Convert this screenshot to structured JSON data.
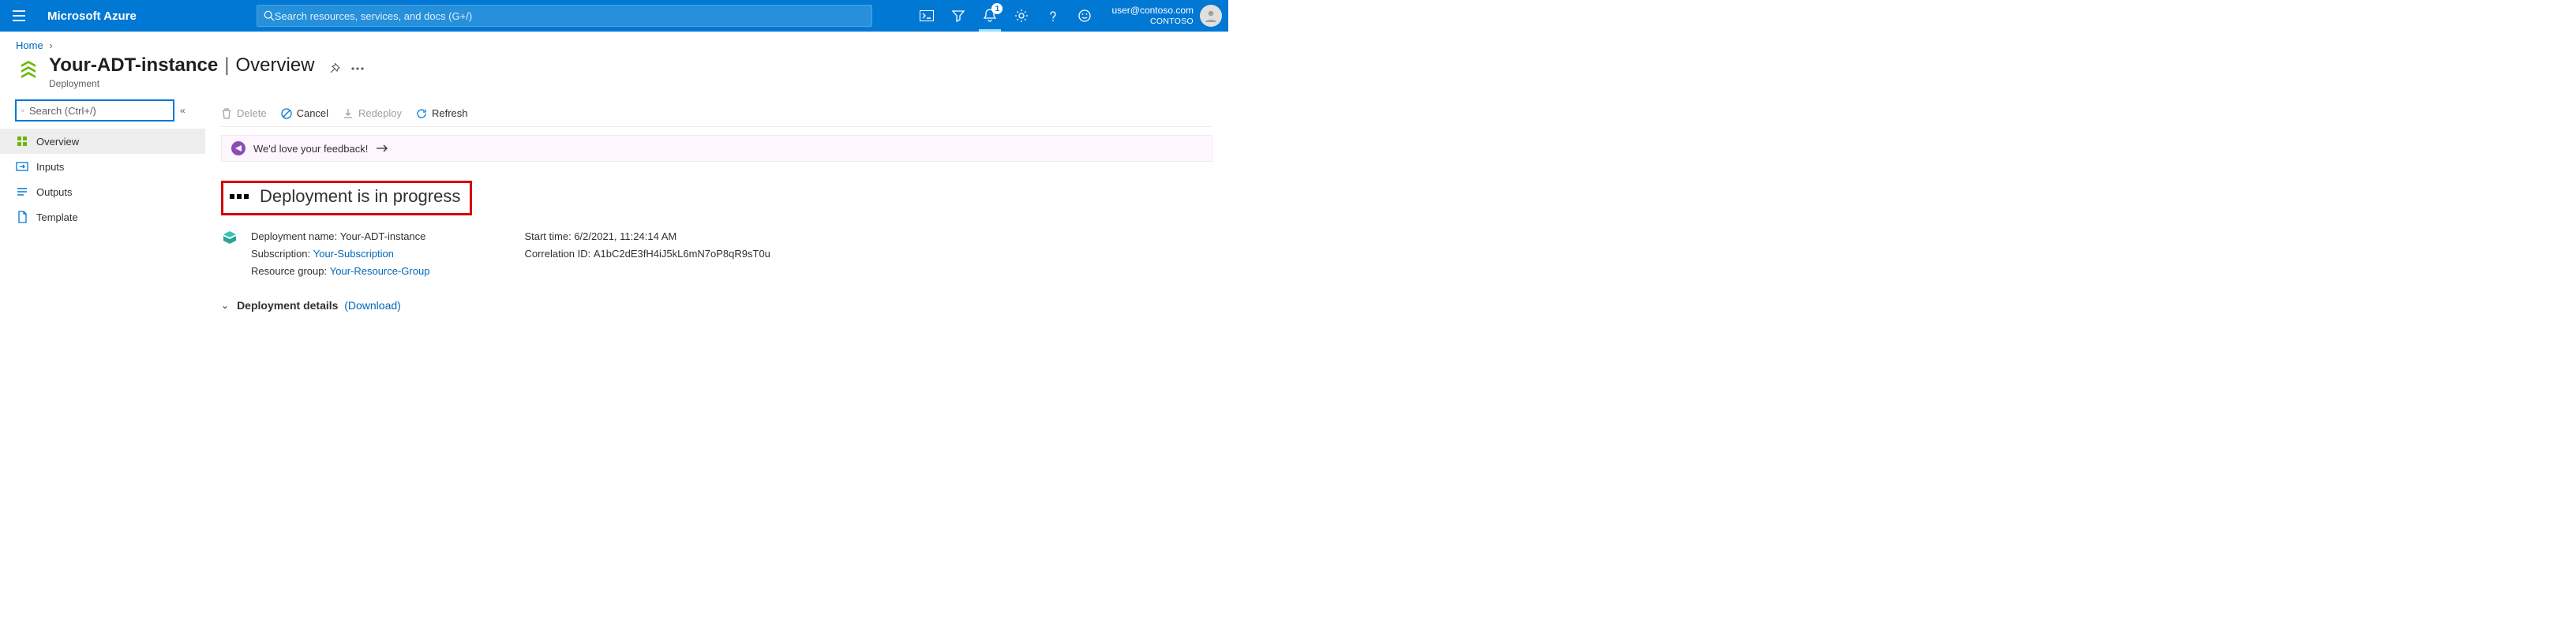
{
  "topbar": {
    "brand": "Microsoft Azure",
    "search_placeholder": "Search resources, services, and docs (G+/)",
    "notification_count": "1",
    "user_email": "user@contoso.com",
    "tenant": "CONTOSO"
  },
  "breadcrumb": {
    "home": "Home"
  },
  "title": {
    "name": "Your-ADT-instance",
    "section": "Overview",
    "subtype": "Deployment"
  },
  "sidebar": {
    "search_placeholder": "Search (Ctrl+/)",
    "items": [
      {
        "label": "Overview"
      },
      {
        "label": "Inputs"
      },
      {
        "label": "Outputs"
      },
      {
        "label": "Template"
      }
    ]
  },
  "toolbar": {
    "delete": "Delete",
    "cancel": "Cancel",
    "redeploy": "Redeploy",
    "refresh": "Refresh"
  },
  "feedback": {
    "text": "We'd love your feedback!"
  },
  "status": {
    "heading": "Deployment is in progress"
  },
  "details": {
    "deployment_name_label": "Deployment name:",
    "deployment_name": "Your-ADT-instance",
    "subscription_label": "Subscription:",
    "subscription": "Your-Subscription",
    "resource_group_label": "Resource group:",
    "resource_group": "Your-Resource-Group",
    "start_time_label": "Start time:",
    "start_time": "6/2/2021, 11:24:14 AM",
    "correlation_label": "Correlation ID:",
    "correlation_id": "A1bC2dE3fH4iJ5kL6mN7oP8qR9sT0u"
  },
  "dep_details": {
    "label": "Deployment details",
    "download": "(Download)"
  }
}
